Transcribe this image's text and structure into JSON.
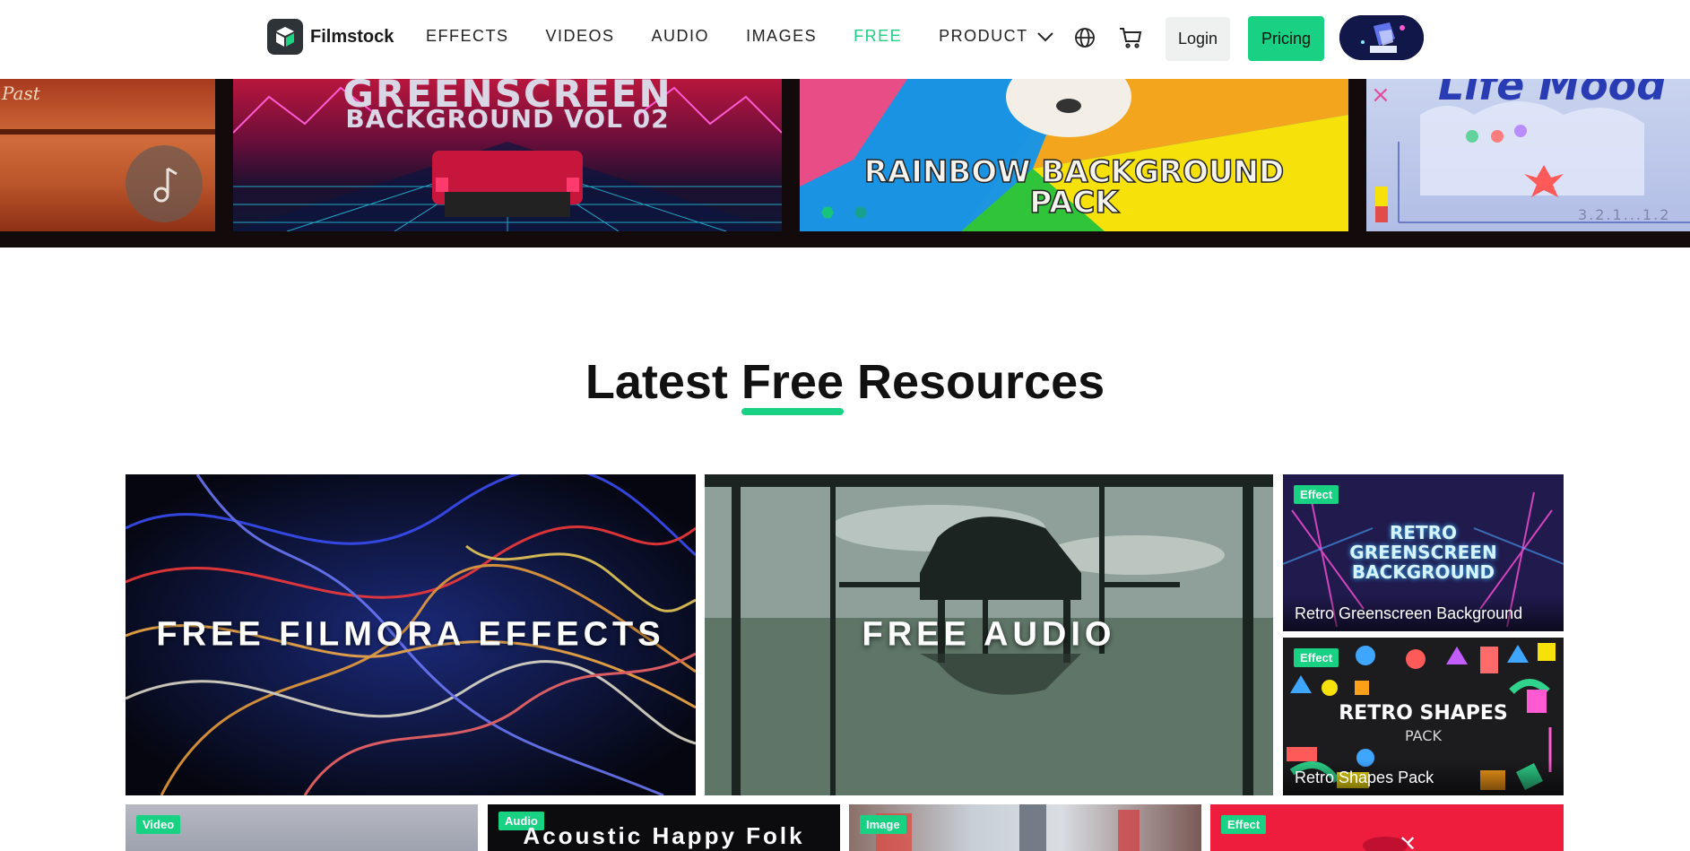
{
  "header": {
    "brand": "Filmstock",
    "nav": [
      "EFFECTS",
      "VIDEOS",
      "AUDIO",
      "IMAGES",
      "FREE",
      "PRODUCT"
    ],
    "active_nav": "FREE",
    "login": "Login",
    "pricing": "Pricing"
  },
  "banner": {
    "tile_past": "Past",
    "tile_greenscreen_title": "GREENSCREEN",
    "tile_greenscreen_sub": "BACKGROUND VOL 02",
    "tile_rainbow_line1": "RAINBOW BACKGROUND",
    "tile_rainbow_line2": "PACK",
    "tile_life_title": "Life Mood",
    "tile_life_counter": "3.2.1...1.2"
  },
  "section": {
    "title_before": "Latest ",
    "title_highlight": "Free",
    "title_after": " Resources"
  },
  "cards": {
    "effects": {
      "label": "FREE FILMORA EFFECTS"
    },
    "audio": {
      "label": "FREE AUDIO"
    },
    "retro_bg": {
      "tag": "Effect",
      "art_line1": "RETRO",
      "art_line2": "GREENSCREEN",
      "art_line3": "BACKGROUND",
      "caption": "Retro Greenscreen Background"
    },
    "retro_shapes": {
      "tag": "Effect",
      "art_line1": "RETRO SHAPES",
      "art_line2": "PACK",
      "caption": "Retro Shapes Pack"
    },
    "video": {
      "tag": "Video"
    },
    "folk": {
      "tag": "Audio",
      "title": "Acoustic Happy Folk"
    },
    "image": {
      "tag": "Image"
    },
    "effect4": {
      "tag": "Effect"
    }
  },
  "colors": {
    "accent": "#18d183",
    "text": "#111111"
  },
  "icons": [
    "filmstock-logo-icon",
    "chevron-down-icon",
    "globe-icon",
    "cart-icon",
    "music-note-icon"
  ]
}
